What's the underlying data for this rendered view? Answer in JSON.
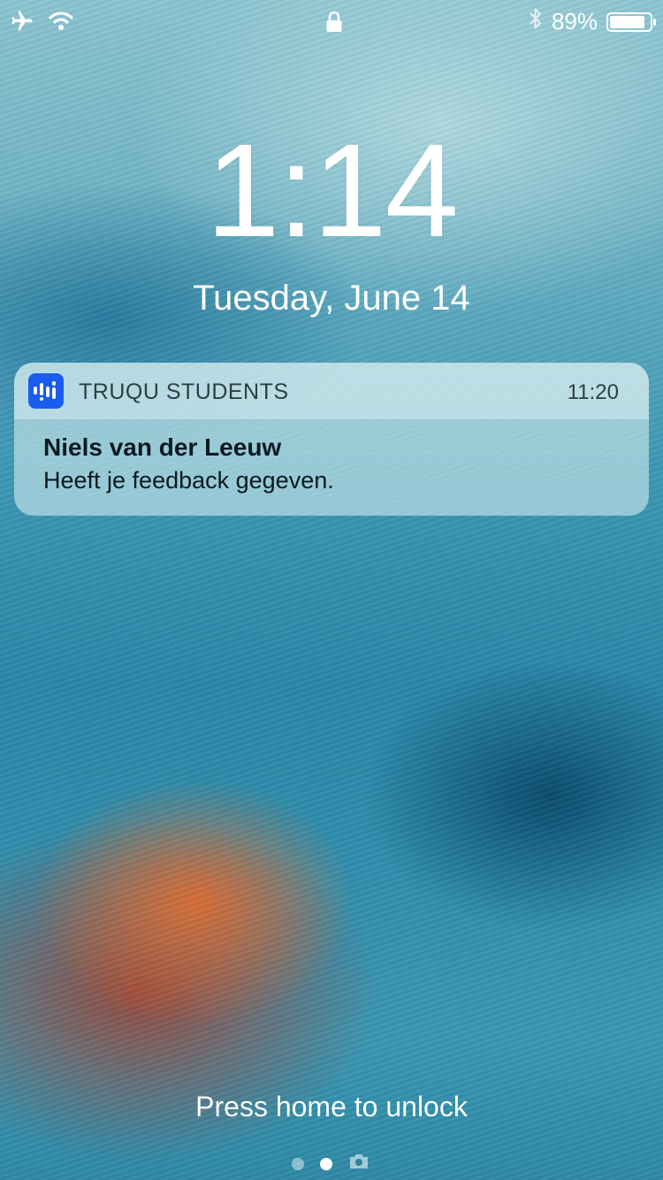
{
  "status_bar": {
    "icons": [
      "airplane-icon",
      "wifi-icon",
      "lock-icon",
      "bluetooth-icon",
      "battery-icon"
    ],
    "battery_percent": "89%",
    "battery_level": 0.89
  },
  "lock_screen": {
    "time": "1:14",
    "date": "Tuesday, June 14"
  },
  "notification": {
    "app_name": "TRUQU STUDENTS",
    "app_icon": "truqu-app-icon",
    "app_icon_color": "#1a5cf0",
    "time": "11:20",
    "title": "Niels van der Leeuw",
    "message": "Heeft je feedback gegeven."
  },
  "bottom": {
    "unlock_hint": "Press home to unlock",
    "page_indicators": [
      "today-dot",
      "lock-dot",
      "camera-icon"
    ],
    "active_page": 1
  }
}
